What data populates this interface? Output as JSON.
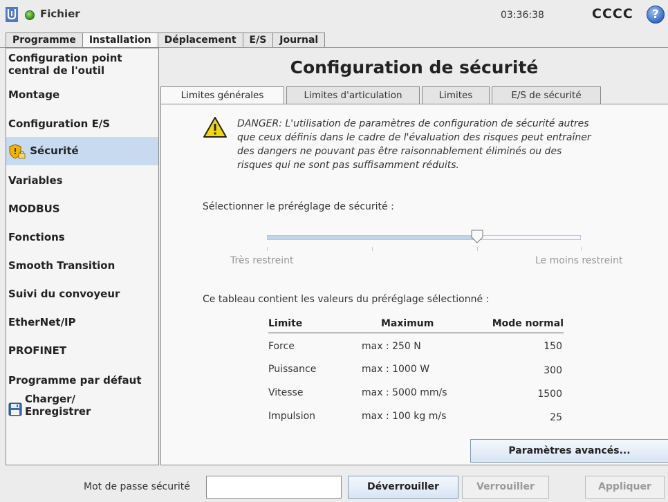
{
  "topbar": {
    "file_menu": "Fichier",
    "clock": "03:36:38",
    "robot_name": "CCCC",
    "help_glyph": "?",
    "status_color": "#3aa624"
  },
  "main_tabs": [
    {
      "label": "Programme",
      "active": false
    },
    {
      "label": "Installation",
      "active": true
    },
    {
      "label": "Déplacement",
      "active": false
    },
    {
      "label": "E/S",
      "active": false
    },
    {
      "label": "Journal",
      "active": false
    }
  ],
  "sidebar": {
    "items": [
      {
        "label_line1": "Configuration point",
        "label_line2": "central de l'outil"
      },
      {
        "label": "Montage"
      },
      {
        "label": "Configuration E/S"
      },
      {
        "label": "Sécurité",
        "icon": "shield-lock-icon",
        "selected": true
      },
      {
        "label": "Variables"
      },
      {
        "label": "MODBUS"
      },
      {
        "label": "Fonctions"
      },
      {
        "label": "Smooth Transition"
      },
      {
        "label": "Suivi du convoyeur"
      },
      {
        "label": "EtherNet/IP"
      },
      {
        "label": "PROFINET"
      },
      {
        "label": "Programme par défaut"
      },
      {
        "label_line1": "Charger/",
        "label_line2": "Enregistrer",
        "icon": "floppy-disk-icon"
      }
    ]
  },
  "content": {
    "title": "Configuration de sécurité",
    "subtabs": [
      {
        "label": "Limites générales",
        "active": true
      },
      {
        "label": "Limites d'articulation",
        "active": false
      },
      {
        "label": "Limites",
        "active": false
      },
      {
        "label": "E/S de sécurité",
        "active": false
      }
    ],
    "danger_lines": [
      "DANGER: L'utilisation de paramètres de configuration de sécurité autres",
      "que ceux définis dans le cadre de l'évaluation des risques peut entraîner",
      "des dangers ne pouvant pas être raisonnablement éliminés ou des",
      "risques qui ne sont pas suffisamment réduits."
    ],
    "preset_label": "Sélectionner le préréglage de sécurité :",
    "slider": {
      "value": 0.67,
      "label_low": "Très restreint",
      "label_high": "Le moins restreint"
    },
    "table_caption": "Ce tableau contient les valeurs du préréglage sélectionné :",
    "table": {
      "headers": [
        "Limite",
        "Maximum",
        "Mode normal"
      ],
      "rows": [
        [
          "Force",
          "max : 250 N",
          "150"
        ],
        [
          "Puissance",
          "max : 1000 W",
          "300"
        ],
        [
          "Vitesse",
          "max : 5000 mm/s",
          "1500"
        ],
        [
          "Impulsion",
          "max : 100 kg m/s",
          "25"
        ]
      ]
    },
    "advanced_button": "Paramètres avancés..."
  },
  "bottom": {
    "password_label": "Mot de passe sécurité",
    "password_value": "",
    "unlock_button": "Déverrouiller",
    "lock_button": "Verrouiller",
    "apply_button": "Appliquer"
  },
  "colors": {
    "selected_bg": "#c7daf0",
    "button_gradient_top": "#f4f8fd",
    "button_gradient_bottom": "#d8e5f4",
    "warning_yellow": "#f5d800"
  }
}
